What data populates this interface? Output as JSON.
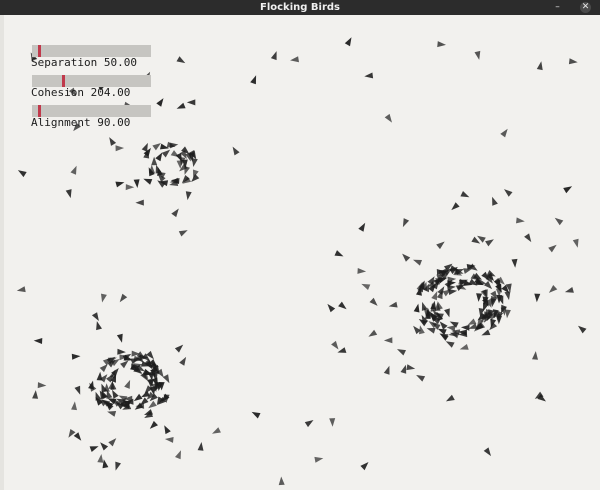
{
  "window": {
    "title": "Flocking Birds",
    "minimize_icon": "minimize-icon",
    "close_icon": "close-icon",
    "minimize_glyph": "–",
    "close_glyph": "✕"
  },
  "controls": {
    "sliders": [
      {
        "name": "Separation",
        "label": "Separation 50.00",
        "value": 50.0,
        "fraction": 0.05
      },
      {
        "name": "Cohesion",
        "label": "Cohesion 204.00",
        "value": 204.0,
        "fraction": 0.25
      },
      {
        "name": "Alignment",
        "label": "Alignment 90.00",
        "value": 90.0,
        "fraction": 0.05
      }
    ]
  },
  "colors": {
    "background": "#f2f1ee",
    "titlebar": "#2c2c2c",
    "slider_track": "#c6c5c1",
    "slider_thumb": "#c0394b",
    "bird": "#1c1c1c"
  }
}
